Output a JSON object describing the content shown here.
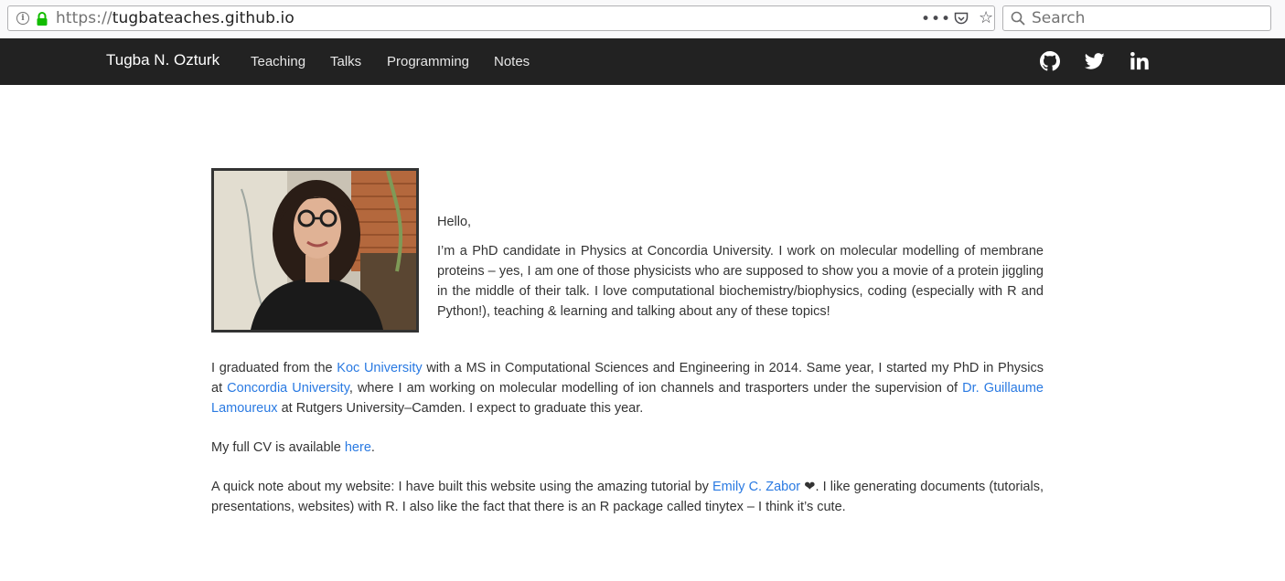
{
  "browser": {
    "url_protocol": "https://",
    "url_host": "tugbateaches.github.io",
    "search_placeholder": "Search",
    "more_label": "•••"
  },
  "navbar": {
    "brand": "Tugba N. Ozturk",
    "links": [
      "Teaching",
      "Talks",
      "Programming",
      "Notes"
    ],
    "social_icons": [
      "github-icon",
      "twitter-icon",
      "linkedin-icon"
    ]
  },
  "intro": {
    "greeting": "Hello,",
    "paragraph": "I’m a PhD candidate in Physics at Concordia University. I work on molecular modelling of membrane proteins – yes, I am one of those physicists who are supposed to show you a movie of a protein jiggling in the middle of their talk. I love computational biochemistry/biophysics, coding (especially with R and Python!), teaching & learning and talking about any of these topics!"
  },
  "education": {
    "t1": "I graduated from the ",
    "link1": "Koc University",
    "t2": " with a MS in Computational Sciences and Engineering in 2014. Same year, I started my PhD in Physics at ",
    "link2": "Concordia University",
    "t3": ", where I am working on molecular modelling of ion channels and trasporters under the supervision of ",
    "link3": "Dr. Guillaume Lamoureux",
    "t4": " at Rutgers University–Camden. I expect to graduate this year."
  },
  "cv": {
    "t1": "My full CV is available ",
    "link": "here",
    "t2": "."
  },
  "website_note": {
    "t1": "A quick note about my website: I have built this website using the amazing tutorial by ",
    "link": "Emily C. Zabor",
    "heart": " ❤",
    "t2": ". I like generating documents (tutorials, presentations, websites) with R. I also like the fact that there is an R package called tinytex – I think it’s cute."
  },
  "colors": {
    "navbar_bg": "#222222",
    "link": "#2a7ae2",
    "lock_green": "#12bc00"
  }
}
